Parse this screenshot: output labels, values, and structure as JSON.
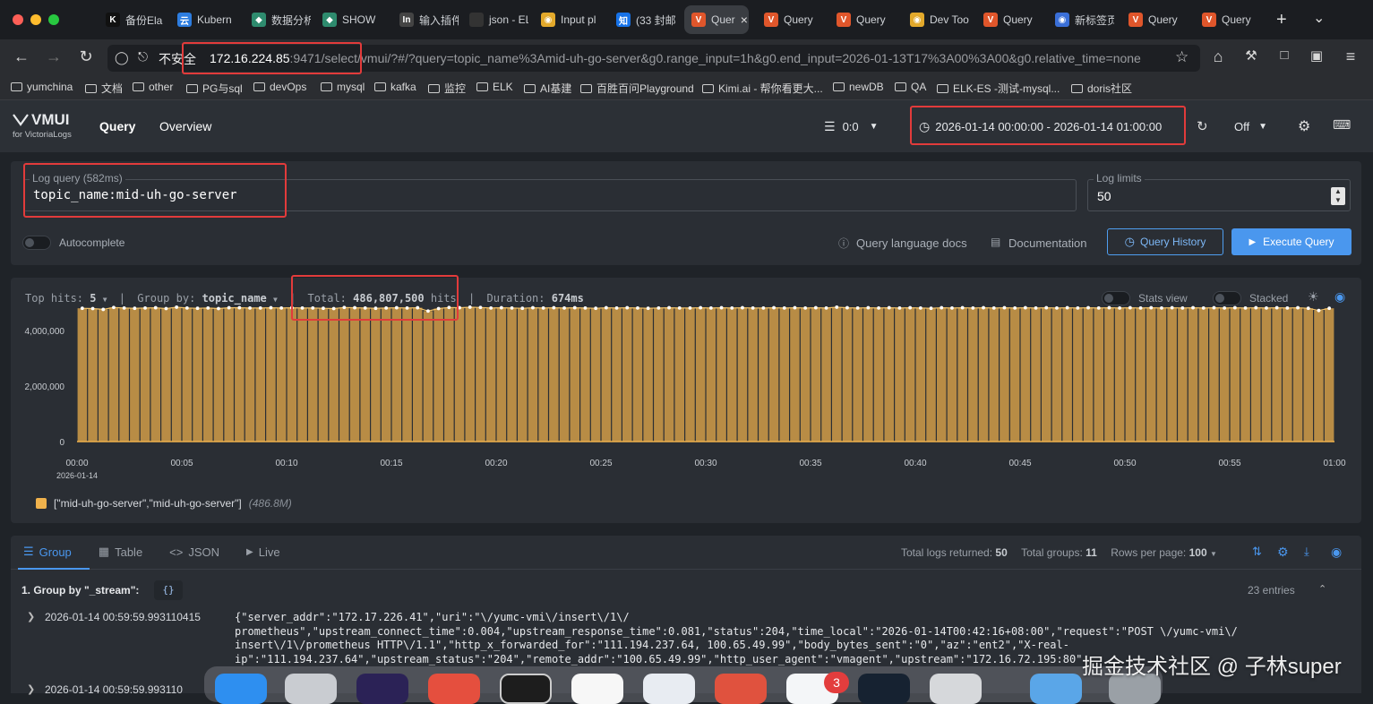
{
  "browser": {
    "tabs": [
      {
        "label": "备份Ela",
        "icon": "K",
        "color": "#111"
      },
      {
        "label": "Kubern",
        "icon": "云",
        "color": "#2d7de0"
      },
      {
        "label": "数据分析",
        "icon": "◆",
        "color": "#2e8b6e"
      },
      {
        "label": "SHOW",
        "icon": "◆",
        "color": "#2e8b6e"
      },
      {
        "label": "输入插件",
        "icon": "In",
        "color": "#444"
      },
      {
        "label": "json - ELKsi",
        "icon": "",
        "color": "#333"
      },
      {
        "label": "Input pl",
        "icon": "◉",
        "color": "#e3a92b"
      },
      {
        "label": "(33 封邮",
        "icon": "知",
        "color": "#1672e8"
      },
      {
        "label": "Quer",
        "icon": "V",
        "color": "#e0562b",
        "active": true
      },
      {
        "label": "Query",
        "icon": "V",
        "color": "#e0562b"
      },
      {
        "label": "Query",
        "icon": "V",
        "color": "#e0562b"
      },
      {
        "label": "Dev Too",
        "icon": "◉",
        "color": "#e3a92b"
      },
      {
        "label": "Query",
        "icon": "V",
        "color": "#e0562b"
      },
      {
        "label": "新标签页",
        "icon": "◉",
        "color": "#3a6fd8"
      },
      {
        "label": "Query",
        "icon": "V",
        "color": "#e0562b"
      },
      {
        "label": "Query",
        "icon": "V",
        "color": "#e0562b"
      }
    ],
    "new_tab": "+",
    "tab_menu": "⌄",
    "insecure_label": "不安全",
    "url_host": "172.16.224.85",
    "url_rest": ":9471/select/vmui/?#/?query=topic_name%3Amid-uh-go-server&g0.range_input=1h&g0.end_input=2026-01-13T17%3A00%3A00&g0.relative_time=none",
    "bookmarks": [
      "yumchina",
      "文档",
      "other",
      "PG与sql",
      "devOps",
      "mysql",
      "kafka",
      "监控",
      "ELK",
      "AI基建",
      "百胜百问Playground",
      "Kimi.ai - 帮你看更大...",
      "newDB",
      "QA",
      "ELK-ES -测试-mysql...",
      "doris社区"
    ]
  },
  "app": {
    "logo_main": "VMUI",
    "logo_sub": "for VictoriaLogs",
    "nav": [
      "Query",
      "Overview"
    ],
    "tenant": "0:0",
    "time_range": "2026-01-14 00:00:00 - 2026-01-14 01:00:00",
    "refresh": "Off"
  },
  "query_panel": {
    "log_query_label": "Log query (582ms)",
    "log_query_value": "topic_name:mid-uh-go-server",
    "log_limits_label": "Log limits",
    "log_limits_value": "50",
    "autocomplete": "Autocomplete",
    "docs_link": "Query language docs",
    "documentation_link": "Documentation",
    "history_btn": "Query History",
    "execute_btn": "Execute Query"
  },
  "hits_bar": {
    "top_hits_label": "Top hits:",
    "top_hits_value": "5",
    "group_by_label": "Group by:",
    "group_by_value": "topic_name",
    "total_label": "Total:",
    "total_value": "486,807,500",
    "total_unit": "hits",
    "duration_label": "Duration:",
    "duration_value": "674ms",
    "stats_view": "Stats view",
    "stacked": "Stacked"
  },
  "chart_data": {
    "type": "bar",
    "ylim": [
      0,
      5000000
    ],
    "y_ticks": [
      "0",
      "2,000,000",
      "4,000,000"
    ],
    "y_tick_values": [
      0,
      2000000,
      4000000
    ],
    "x_ticks": [
      "00:00",
      "00:05",
      "00:10",
      "00:15",
      "00:20",
      "00:25",
      "00:30",
      "00:35",
      "00:40",
      "00:45",
      "00:50",
      "00:55",
      "01:00"
    ],
    "x_date": "2026-01-14",
    "bar_count": 120,
    "values": [
      4800000,
      4790000,
      4760000,
      4830000,
      4810000,
      4800000,
      4810000,
      4820000,
      4790000,
      4840000,
      4810000,
      4800000,
      4810000,
      4790000,
      4820000,
      4820000,
      4810000,
      4810000,
      4820000,
      4810000,
      4820000,
      4810000,
      4810000,
      4800000,
      4790000,
      4830000,
      4820000,
      4810000,
      4800000,
      4810000,
      4820000,
      4810000,
      4820000,
      4700000,
      4790000,
      4830000,
      4820000,
      4840000,
      4830000,
      4810000,
      4820000,
      4810000,
      4800000,
      4820000,
      4810000,
      4820000,
      4810000,
      4820000,
      4810000,
      4800000,
      4820000,
      4810000,
      4820000,
      4810000,
      4800000,
      4810000,
      4820000,
      4810000,
      4810000,
      4820000,
      4810000,
      4820000,
      4810000,
      4820000,
      4810000,
      4810000,
      4820000,
      4810000,
      4820000,
      4810000,
      4820000,
      4810000,
      4840000,
      4820000,
      4810000,
      4820000,
      4810000,
      4820000,
      4810000,
      4820000,
      4810000,
      4800000,
      4820000,
      4810000,
      4820000,
      4810000,
      4820000,
      4810000,
      4820000,
      4810000,
      4820000,
      4810000,
      4820000,
      4810000,
      4820000,
      4810000,
      4820000,
      4810000,
      4820000,
      4810000,
      4820000,
      4810000,
      4820000,
      4810000,
      4820000,
      4810000,
      4820000,
      4810000,
      4820000,
      4810000,
      4820000,
      4810000,
      4820000,
      4810000,
      4820000,
      4810000,
      4820000,
      4800000,
      4720000,
      4800000
    ],
    "color": "#f0b24c",
    "legend": [
      {
        "name": "[\"mid-uh-go-server\",\"mid-uh-go-server\"]",
        "value_label": "(486.8M)"
      }
    ]
  },
  "results": {
    "tabs": [
      "Group",
      "Table",
      "JSON",
      "Live"
    ],
    "total_logs_label": "Total logs returned:",
    "total_logs_value": "50",
    "total_groups_label": "Total groups:",
    "total_groups_value": "11",
    "rows_per_page_label": "Rows per page:",
    "rows_per_page_value": "100",
    "group_title": "1. Group by \"_stream\":",
    "group_badge": "{}",
    "entries": "23 entries",
    "rows": [
      {
        "time": "2026-01-14 00:59:59.993110415",
        "lines": [
          "{\"server_addr\":\"172.17.226.41\",\"uri\":\"\\/yumc-vmi\\/insert\\/1\\/",
          "prometheus\",\"upstream_connect_time\":0.004,\"upstream_response_time\":0.081,\"status\":204,\"time_local\":\"2026-01-14T00:42:16+08:00\",\"request\":\"POST \\/yumc-vmi\\/",
          "insert\\/1\\/prometheus HTTP\\/1.1\",\"http_x_forwarded_for\":\"111.194.237.64, 100.65.49.99\",\"body_bytes_sent\":\"0\",\"az\":\"ent2\",\"X-real-",
          "ip\":\"111.194.237.64\",\"upstream_status\":\"204\",\"remote_addr\":\"100.65.49.99\",\"http_user_agent\":\"vmagent\",\"upstream\":\"172.16.72.195:80\""
        ]
      },
      {
        "time": "2026-01-14 00:59:59.993110",
        "lines": []
      }
    ]
  },
  "watermark": "掘金技术社区 @ 子林super",
  "dock_badge": "3"
}
